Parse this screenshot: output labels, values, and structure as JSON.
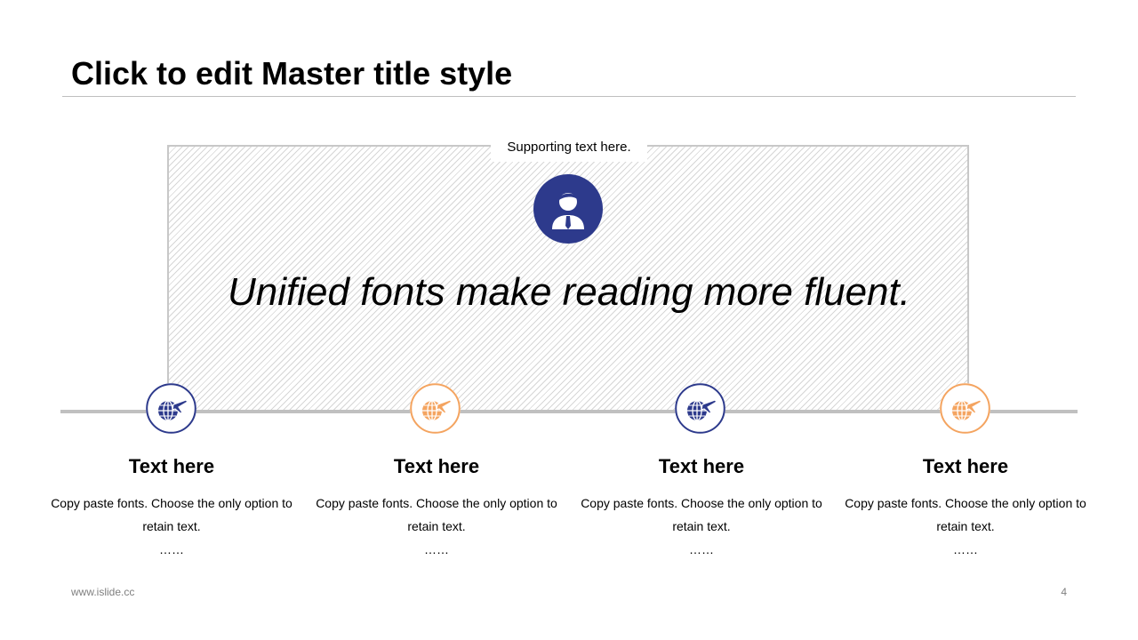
{
  "slide": {
    "title": "Click to edit Master title style",
    "supporting_text": "Supporting text here.",
    "quote": "Unified fonts make reading more fluent.",
    "icon": "person-icon"
  },
  "colors": {
    "navy": "#2d3a8c",
    "orange": "#f4a460",
    "line": "#c0c0c0"
  },
  "items": [
    {
      "title": "Text here",
      "text": "Copy paste fonts. Choose the only option to retain text.",
      "dots": "……",
      "icon": "globe-plane-icon",
      "color": "navy"
    },
    {
      "title": "Text here",
      "text": "Copy paste fonts. Choose the only option to retain text.",
      "dots": "……",
      "icon": "globe-plane-icon",
      "color": "orange"
    },
    {
      "title": "Text here",
      "text": "Copy paste fonts. Choose the only option to retain text.",
      "dots": "……",
      "icon": "globe-plane-icon",
      "color": "navy"
    },
    {
      "title": "Text here",
      "text": "Copy paste fonts. Choose the only option to retain text.",
      "dots": "……",
      "icon": "globe-plane-icon",
      "color": "orange"
    }
  ],
  "footer": {
    "website": "www.islide.cc",
    "page_number": "4"
  }
}
